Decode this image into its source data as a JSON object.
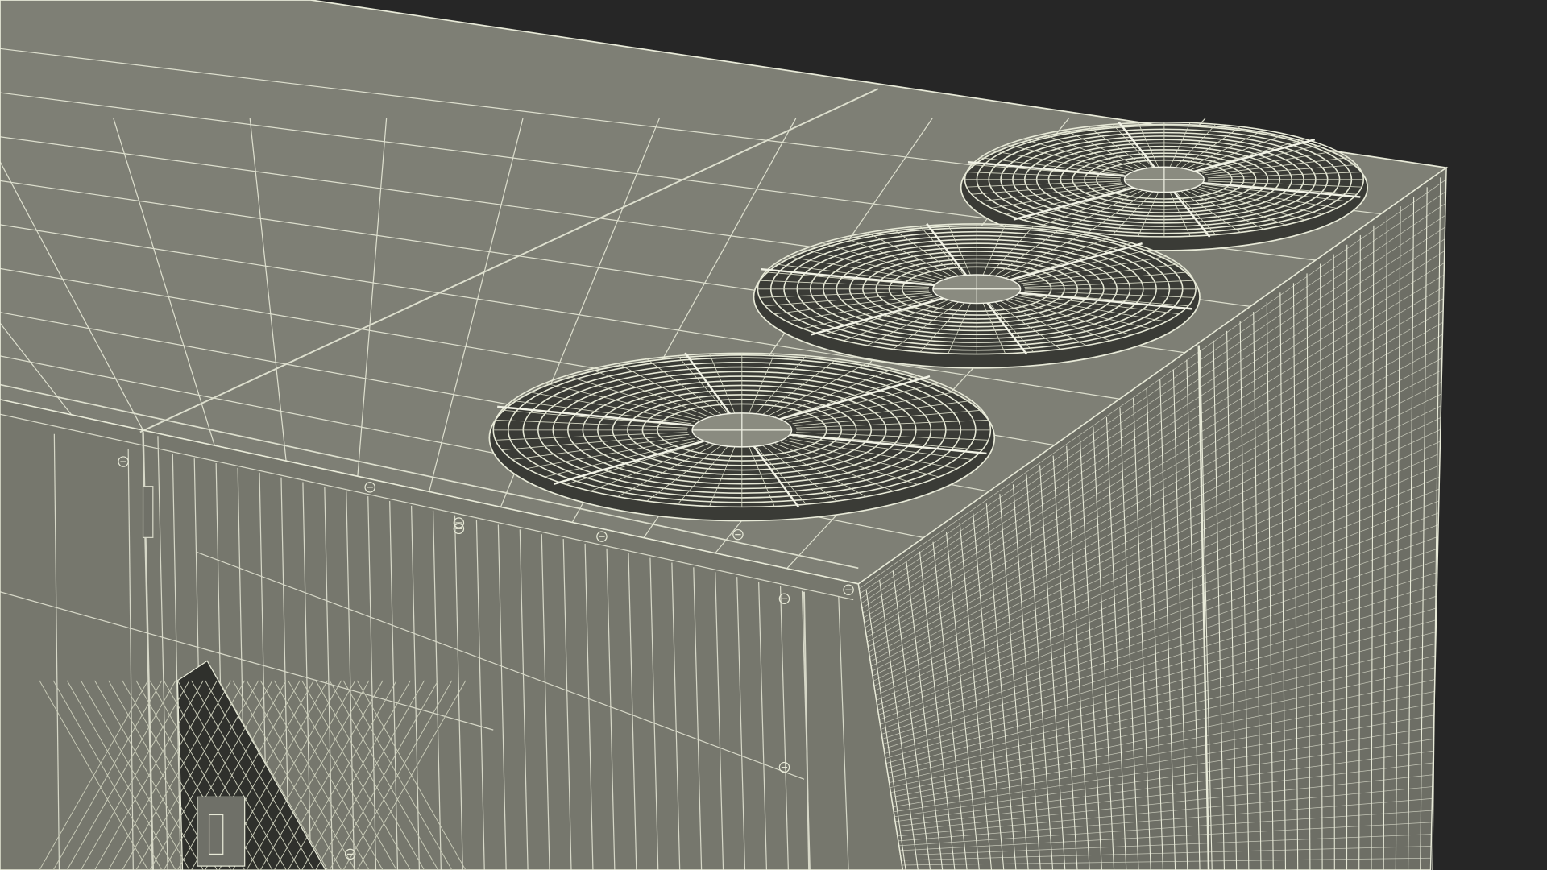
{
  "scene": {
    "subject": "rooftop-packaged-ac-unit-wireframe",
    "fan_count": 3,
    "colors": {
      "background": "#262626",
      "body_fill": "#7b7c72",
      "body_fill_top": "#7e7f75",
      "body_fill_side": "#74756c",
      "coil_fill": "#6c6d64",
      "wire": "#e8ead8",
      "wire_dim": "#c9cbb8",
      "grille_dark": "#2f302c"
    }
  }
}
